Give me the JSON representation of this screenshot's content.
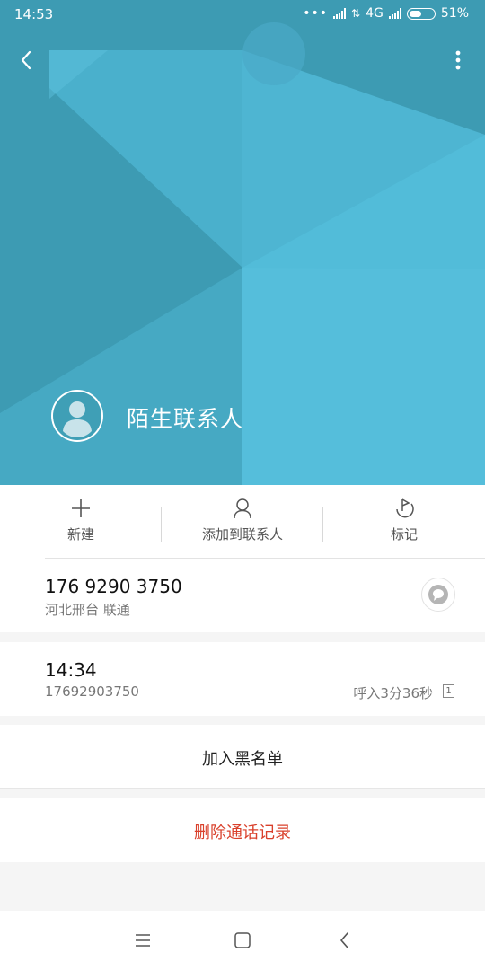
{
  "status_bar": {
    "time": "14:53",
    "network": "4G",
    "battery": "51%",
    "battery_level": 0.51
  },
  "header": {
    "contact_name": "陌生联系人",
    "back_icon": "chevron-left-icon",
    "more_icon": "more-vertical-icon",
    "colors": {
      "base": "#3f9fb6",
      "light": "#52b9d7"
    }
  },
  "actions": [
    {
      "label": "新建",
      "icon": "plus-icon"
    },
    {
      "label": "添加到联系人",
      "icon": "person-icon"
    },
    {
      "label": "标记",
      "icon": "flag-icon"
    }
  ],
  "phone": {
    "number": "176 9290 3750",
    "location": "河北邢台 联通",
    "message_icon": "message-bubble-icon"
  },
  "call_log": {
    "time": "14:34",
    "number": "17692903750",
    "detail": "呼入3分36秒",
    "sim": "1"
  },
  "block_label": "加入黑名单",
  "delete_label": "删除通话记录",
  "delete_color": "#d9402b",
  "nav": [
    "menu-icon",
    "home-icon",
    "back-icon"
  ]
}
